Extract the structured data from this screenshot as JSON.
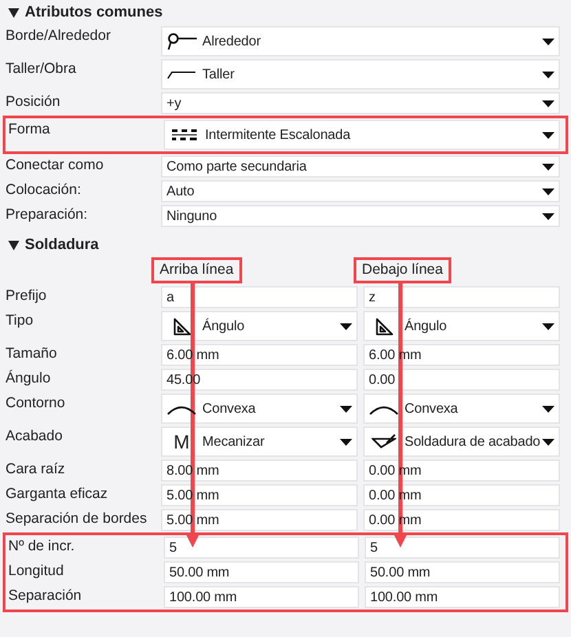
{
  "common": {
    "title": "Atributos comunes",
    "expanded": true,
    "rows": [
      {
        "label": "Borde/Alrededor",
        "highlighted": false,
        "cells": [
          {
            "kind": "select",
            "value": "Alrededor"
          }
        ]
      },
      {
        "label": "Taller/Obra",
        "highlighted": false,
        "cells": [
          {
            "kind": "select",
            "value": "Taller"
          }
        ]
      },
      {
        "label": "Posición",
        "highlighted": false,
        "cells": [
          {
            "kind": "select",
            "value": "+y"
          }
        ]
      },
      {
        "label": "Forma",
        "highlighted": true,
        "cells": [
          {
            "kind": "select",
            "value": "Intermitente Escalonada"
          }
        ]
      },
      {
        "label": "Conectar como",
        "highlighted": false,
        "cells": [
          {
            "kind": "select",
            "value": "Como parte secundaria"
          }
        ]
      },
      {
        "label": "Colocación:",
        "highlighted": false,
        "cells": [
          {
            "kind": "select",
            "value": "Auto"
          }
        ]
      },
      {
        "label": "Preparación:",
        "highlighted": false,
        "cells": [
          {
            "kind": "select",
            "value": "Ninguno"
          }
        ]
      }
    ]
  },
  "weld": {
    "title": "Soldadura",
    "expanded": true,
    "columns": [
      {
        "label": "Arriba línea",
        "highlighted": true,
        "arrow": true
      },
      {
        "label": "Debajo línea",
        "highlighted": true,
        "arrow": true
      }
    ],
    "rows": [
      {
        "label": "Prefijo",
        "highlighted": false,
        "cells": [
          {
            "kind": "text",
            "value": "a"
          },
          {
            "kind": "text",
            "value": "z"
          }
        ]
      },
      {
        "label": "Tipo",
        "highlighted": false,
        "cells": [
          {
            "kind": "select",
            "value": "Ángulo"
          },
          {
            "kind": "select",
            "value": "Ángulo"
          }
        ]
      },
      {
        "label": "Tamaño",
        "highlighted": false,
        "cells": [
          {
            "kind": "text",
            "value": "6.00 mm"
          },
          {
            "kind": "text",
            "value": "6.00 mm"
          }
        ]
      },
      {
        "label": "Ángulo",
        "highlighted": false,
        "cells": [
          {
            "kind": "text",
            "value": "45.00"
          },
          {
            "kind": "text",
            "value": "0.00"
          }
        ]
      },
      {
        "label": "Contorno",
        "highlighted": false,
        "cells": [
          {
            "kind": "select",
            "value": "Convexa"
          },
          {
            "kind": "select",
            "value": "Convexa"
          }
        ]
      },
      {
        "label": "Acabado",
        "highlighted": false,
        "cells": [
          {
            "kind": "select",
            "glyph": "M",
            "value": "Mecanizar"
          },
          {
            "kind": "select",
            "value": "Soldadura de acabado"
          }
        ]
      },
      {
        "label": "Cara raíz",
        "highlighted": false,
        "cells": [
          {
            "kind": "text",
            "value": "8.00 mm"
          },
          {
            "kind": "text",
            "value": "0.00 mm"
          }
        ]
      },
      {
        "label": "Garganta eficaz",
        "highlighted": false,
        "cells": [
          {
            "kind": "text",
            "value": "5.00 mm"
          },
          {
            "kind": "text",
            "value": "0.00 mm"
          }
        ]
      },
      {
        "label": "Separación de bordes",
        "highlighted": false,
        "cells": [
          {
            "kind": "text",
            "value": "5.00 mm"
          },
          {
            "kind": "text",
            "value": "0.00 mm"
          }
        ]
      },
      {
        "label": "Nº de incr.",
        "highlighted": true,
        "cells": [
          {
            "kind": "text",
            "value": "5"
          },
          {
            "kind": "text",
            "value": "5"
          }
        ]
      },
      {
        "label": "Longitud",
        "highlighted": true,
        "cells": [
          {
            "kind": "text",
            "value": "50.00 mm"
          },
          {
            "kind": "text",
            "value": "50.00 mm"
          }
        ]
      },
      {
        "label": "Separación",
        "highlighted": true,
        "cells": [
          {
            "kind": "text",
            "value": "100.00 mm"
          },
          {
            "kind": "text",
            "value": "100.00 mm"
          }
        ]
      }
    ]
  }
}
